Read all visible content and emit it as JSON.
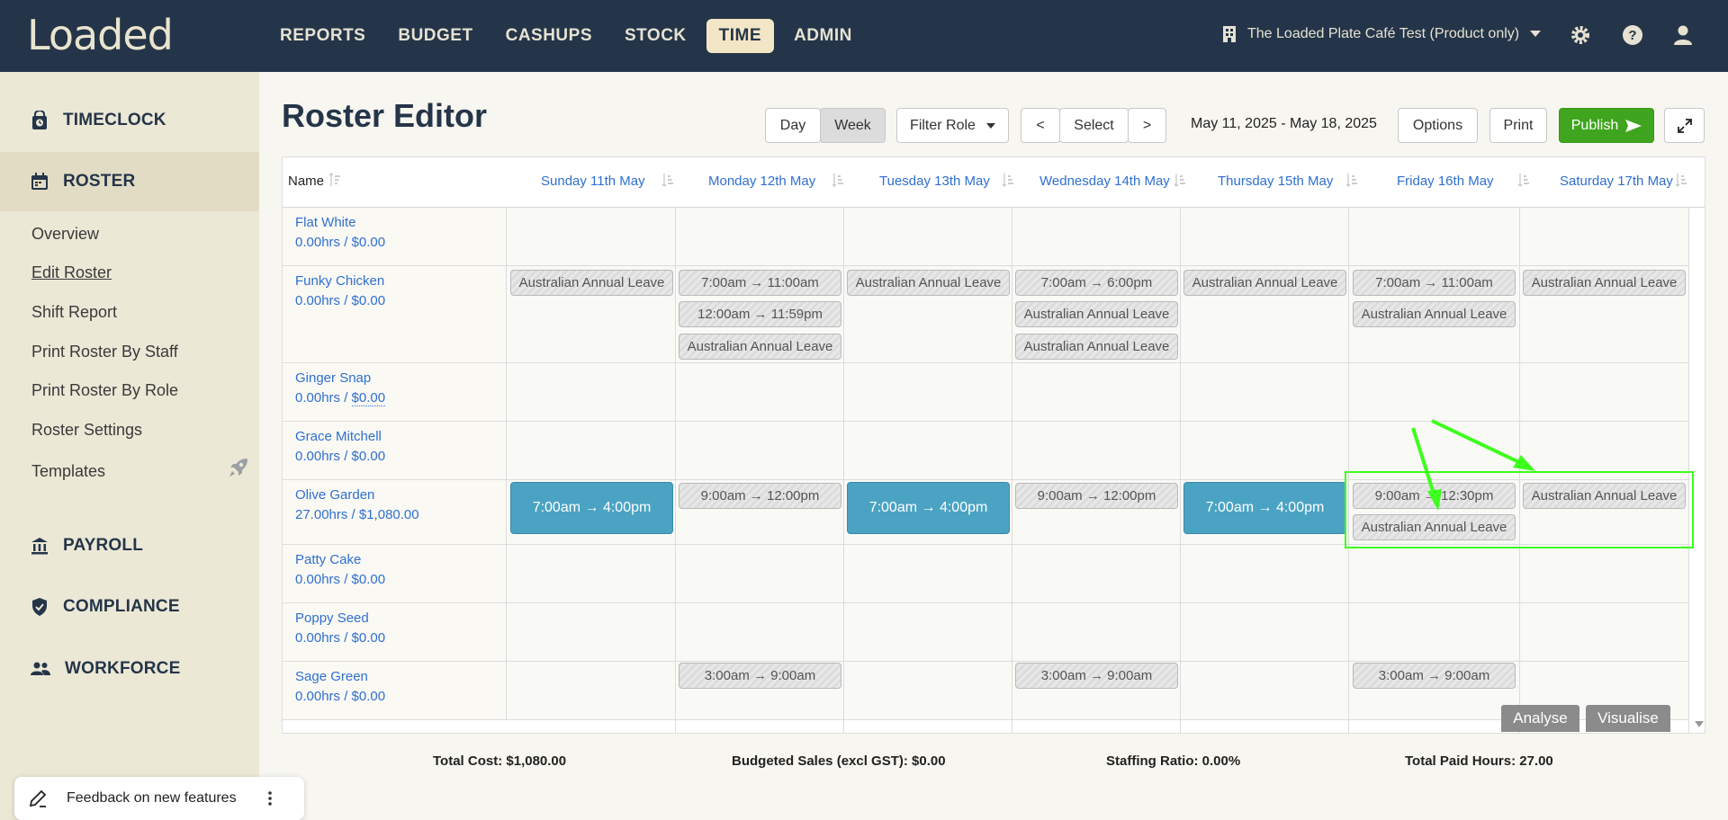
{
  "app": {
    "logo": "Loaded",
    "nav": [
      "REPORTS",
      "BUDGET",
      "CASHUPS",
      "STOCK",
      "TIME",
      "ADMIN"
    ],
    "active_nav": "TIME",
    "store_name": "The Loaded Plate Café Test (Product only)"
  },
  "sidebar": {
    "sections": [
      {
        "label": "TIMECLOCK",
        "icon": "lock-clock-icon"
      },
      {
        "label": "ROSTER",
        "icon": "calendar-icon"
      },
      {
        "label": "PAYROLL",
        "icon": "bank-icon"
      },
      {
        "label": "COMPLIANCE",
        "icon": "shield-check-icon"
      },
      {
        "label": "WORKFORCE",
        "icon": "people-icon"
      }
    ],
    "links": [
      "Overview",
      "Edit Roster",
      "Shift Report",
      "Print Roster By Staff",
      "Print Roster By Role",
      "Roster Settings",
      "Templates"
    ],
    "feedback": "Feedback on new features"
  },
  "header": {
    "title": "Roster Editor",
    "day": "Day",
    "week": "Week",
    "filter_role": "Filter Role",
    "prev": "<",
    "select": "Select",
    "next": ">",
    "date_range": "May 11, 2025 - May 18, 2025",
    "options": "Options",
    "print": "Print",
    "publish": "Publish"
  },
  "grid": {
    "name_header": "Name",
    "days": [
      "Sunday 11th May",
      "Monday 12th May",
      "Tuesday 13th May",
      "Wednesday 14th May",
      "Thursday 15th May",
      "Friday 16th May",
      "Saturday 17th May"
    ],
    "employees": [
      {
        "name": "Flat White",
        "stats": "0.00hrs / $0.00"
      },
      {
        "name": "Funky Chicken",
        "stats": "0.00hrs / $0.00"
      },
      {
        "name": "Ginger Snap",
        "stats_hours": "0.00hrs / ",
        "stats_cost": "$0.00"
      },
      {
        "name": "Grace Mitchell",
        "stats": "0.00hrs / $0.00"
      },
      {
        "name": "Olive Garden",
        "stats": "27.00hrs / $1,080.00"
      },
      {
        "name": "Patty Cake",
        "stats": "0.00hrs / $0.00"
      },
      {
        "name": "Poppy Seed",
        "stats": "0.00hrs / $0.00"
      },
      {
        "name": "Sage Green",
        "stats": "0.00hrs / $0.00"
      }
    ],
    "shifts": {
      "leave": "Australian Annual Leave",
      "s_7_11": "7:00am → 11:00am",
      "s_12_1159": "12:00am → 11:59pm",
      "s_7_6": "7:00am → 6:00pm",
      "s_7_4": "7:00am → 4:00pm",
      "s_9_12": "9:00am → 12:00pm",
      "s_9_1230": "9:00am → 12:30pm",
      "s_3_9": "3:00am → 9:00am"
    },
    "analyse": "Analyse",
    "visualise": "Visualise"
  },
  "totals": {
    "cost": "Total Cost: $1,080.00",
    "sales": "Budgeted Sales (excl GST): $0.00",
    "ratio": "Staffing Ratio: 0.00%",
    "hours": "Total Paid Hours: 27.00"
  },
  "colors": {
    "topbar": "#253549",
    "publish": "#3fa51e",
    "work_shift": "#4ba3c3",
    "annotation": "#3dff1c"
  }
}
